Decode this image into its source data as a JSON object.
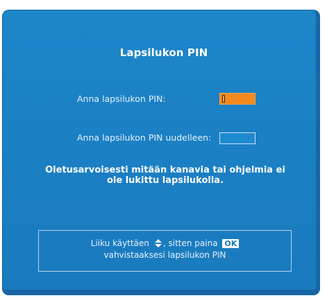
{
  "dialog": {
    "title": "Lapsilukon PIN",
    "enter_pin_label": "Anna lapsilukon PIN:",
    "reenter_pin_label": "Anna lapsilukon PIN uudelleen:",
    "notice": "Oletusarvoisesti mitään kanavia tai ohjelmia ei ole lukittu lapsilukolla.",
    "help": {
      "move_prefix": "Liiku käyttäen",
      "updown_icon": "up-down-arrow-icon",
      "move_suffix": ", sitten paina",
      "ok_key_label": "OK",
      "confirm_text": "vahvistaaksesi lapsilukon PIN"
    }
  },
  "colors": {
    "dialog_background": "#1b80c4",
    "active_field": "#f38a1f",
    "text": "#ffffff"
  }
}
